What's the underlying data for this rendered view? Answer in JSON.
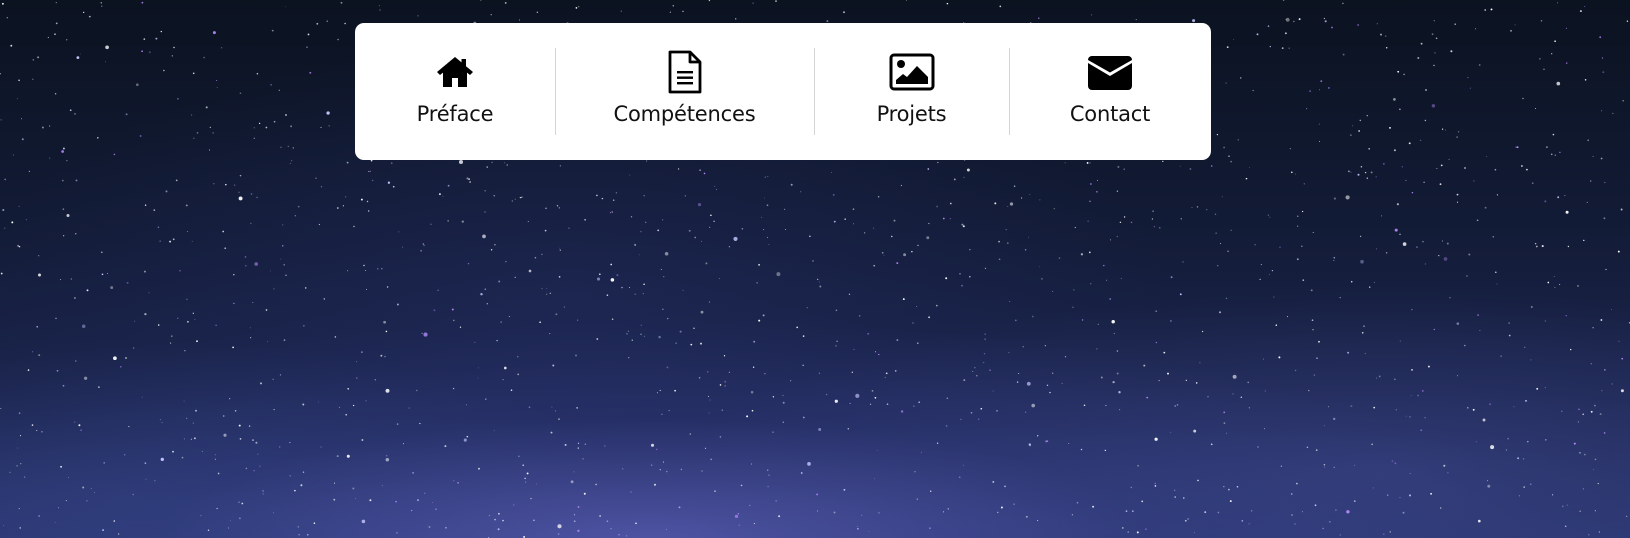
{
  "background": {
    "description_icon": "starry-night-sky",
    "colors": {
      "sky_top": "#0b1220",
      "sky_bottom": "#27336a",
      "glow": "#6e6ed2"
    }
  },
  "nav": {
    "items": [
      {
        "label": "Préface",
        "icon": "home-icon"
      },
      {
        "label": "Compétences",
        "icon": "document-icon"
      },
      {
        "label": "Projets",
        "icon": "image-icon"
      },
      {
        "label": "Contact",
        "icon": "envelope-icon"
      }
    ]
  }
}
